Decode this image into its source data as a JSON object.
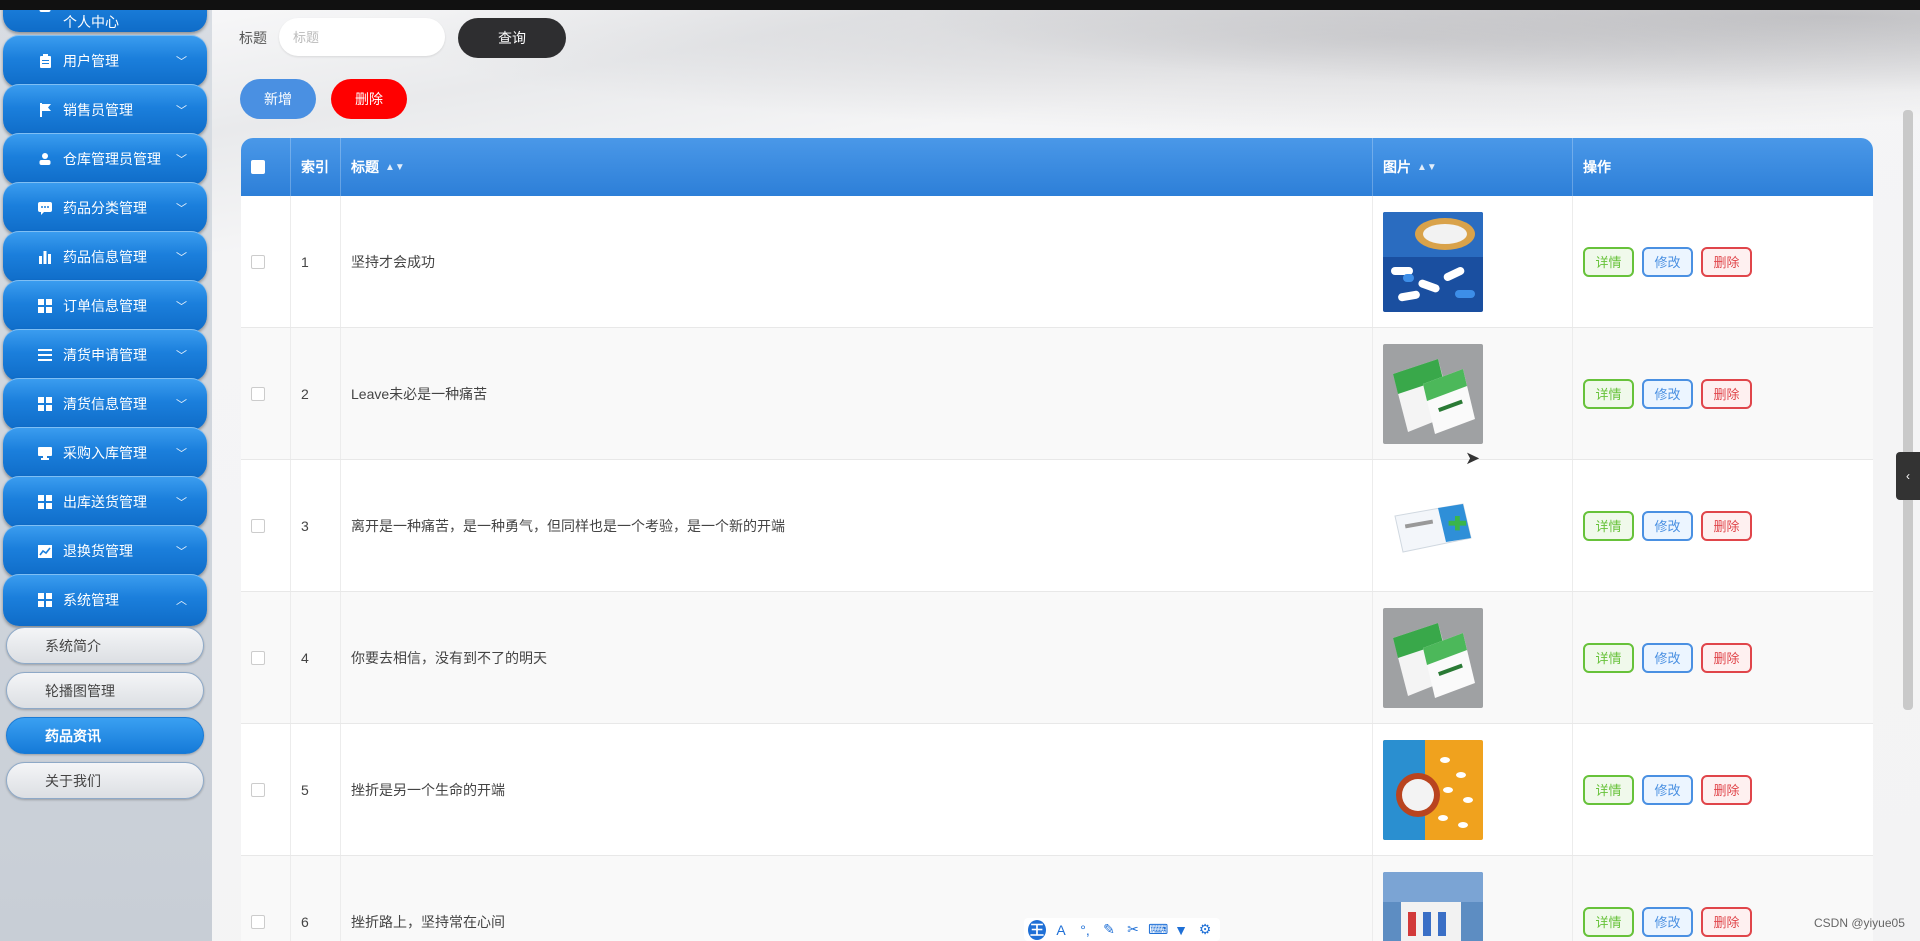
{
  "sidebar": {
    "top_partial_label": "个人中心",
    "items": [
      {
        "label": "用户管理",
        "icon": "clipboard-icon"
      },
      {
        "label": "销售员管理",
        "icon": "flag-icon"
      },
      {
        "label": "仓库管理员管理",
        "icon": "user-icon"
      },
      {
        "label": "药品分类管理",
        "icon": "chat-icon"
      },
      {
        "label": "药品信息管理",
        "icon": "bar-chart-icon"
      },
      {
        "label": "订单信息管理",
        "icon": "grid-icon"
      },
      {
        "label": "清货申请管理",
        "icon": "list-icon"
      },
      {
        "label": "清货信息管理",
        "icon": "grid-icon"
      },
      {
        "label": "采购入库管理",
        "icon": "monitor-icon"
      },
      {
        "label": "出库送货管理",
        "icon": "grid-icon"
      },
      {
        "label": "退换货管理",
        "icon": "line-chart-icon"
      },
      {
        "label": "系统管理",
        "icon": "grid-icon"
      }
    ],
    "subitems": [
      {
        "label": "系统简介"
      },
      {
        "label": "轮播图管理"
      },
      {
        "label": "药品资讯",
        "active": true
      },
      {
        "label": "关于我们"
      }
    ]
  },
  "search": {
    "label": "标题",
    "placeholder": "标题",
    "query_button": "查询"
  },
  "actions": {
    "add_button": "新增",
    "delete_button": "删除"
  },
  "table": {
    "columns": {
      "index": "索引",
      "title": "标题",
      "image": "图片",
      "operation": "操作"
    },
    "row_buttons": {
      "detail": "详情",
      "edit": "修改",
      "delete": "删除"
    },
    "rows": [
      {
        "index": "1",
        "title": "坚持才会成功",
        "image": "blue-capsules-image"
      },
      {
        "index": "2",
        "title": "Leave未必是一种痛苦",
        "image": "green-medicine-box-image"
      },
      {
        "index": "3",
        "title": "离开是一种痛苦，是一种勇气，但同样也是一个考验，是一个新的开端",
        "image": "white-medicine-box-image"
      },
      {
        "index": "4",
        "title": "你要去相信，没有到不了的明天",
        "image": "green-medicine-box-image"
      },
      {
        "index": "5",
        "title": "挫折是另一个生命的开端",
        "image": "pills-bottle-image"
      },
      {
        "index": "6",
        "title": "挫折路上，坚持常在心间",
        "image": "medicine-gift-box-image"
      }
    ]
  },
  "watermark": "CSDN @yiyue05",
  "colors": {
    "sidebar_blue": "#1b7fdc",
    "header_blue": "#2d7fd8",
    "add_blue": "#4a90e2",
    "delete_red": "#ff0000",
    "query_dark": "#2e2e30"
  }
}
